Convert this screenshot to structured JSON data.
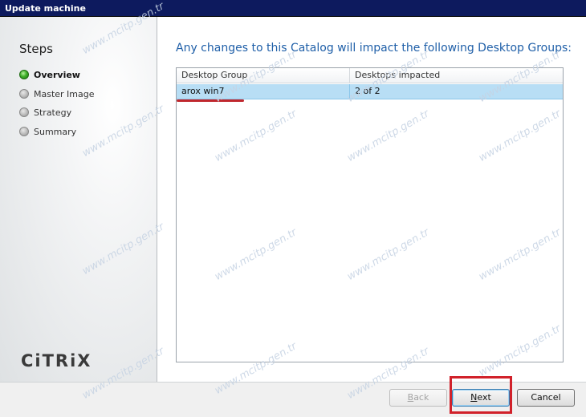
{
  "window": {
    "title": "Update machine"
  },
  "sidebar": {
    "heading": "Steps",
    "steps": [
      {
        "label": "Overview",
        "state": "active"
      },
      {
        "label": "Master Image",
        "state": "inactive"
      },
      {
        "label": "Strategy",
        "state": "inactive"
      },
      {
        "label": "Summary",
        "state": "inactive"
      }
    ],
    "logo_text": "CiTRiX"
  },
  "main": {
    "heading": "Any changes to this Catalog will impact the following Desktop Groups:",
    "table": {
      "columns": [
        "Desktop Group",
        "Desktops impacted"
      ],
      "rows": [
        {
          "desktop_group": "arox win7",
          "desktops_impacted": "2 of 2"
        }
      ]
    }
  },
  "footer": {
    "back": {
      "underline_char": "B",
      "rest": "ack",
      "enabled": false
    },
    "next": {
      "underline_char": "N",
      "rest": "ext",
      "enabled": true
    },
    "cancel": {
      "label": "Cancel",
      "enabled": true
    }
  },
  "watermark": "www.mcitp.gen.tr",
  "colors": {
    "title_bar": "#0d1a5e",
    "heading_blue": "#1f5fa8",
    "row_selected": "#b8def5",
    "annotation_red": "#d1212a"
  }
}
